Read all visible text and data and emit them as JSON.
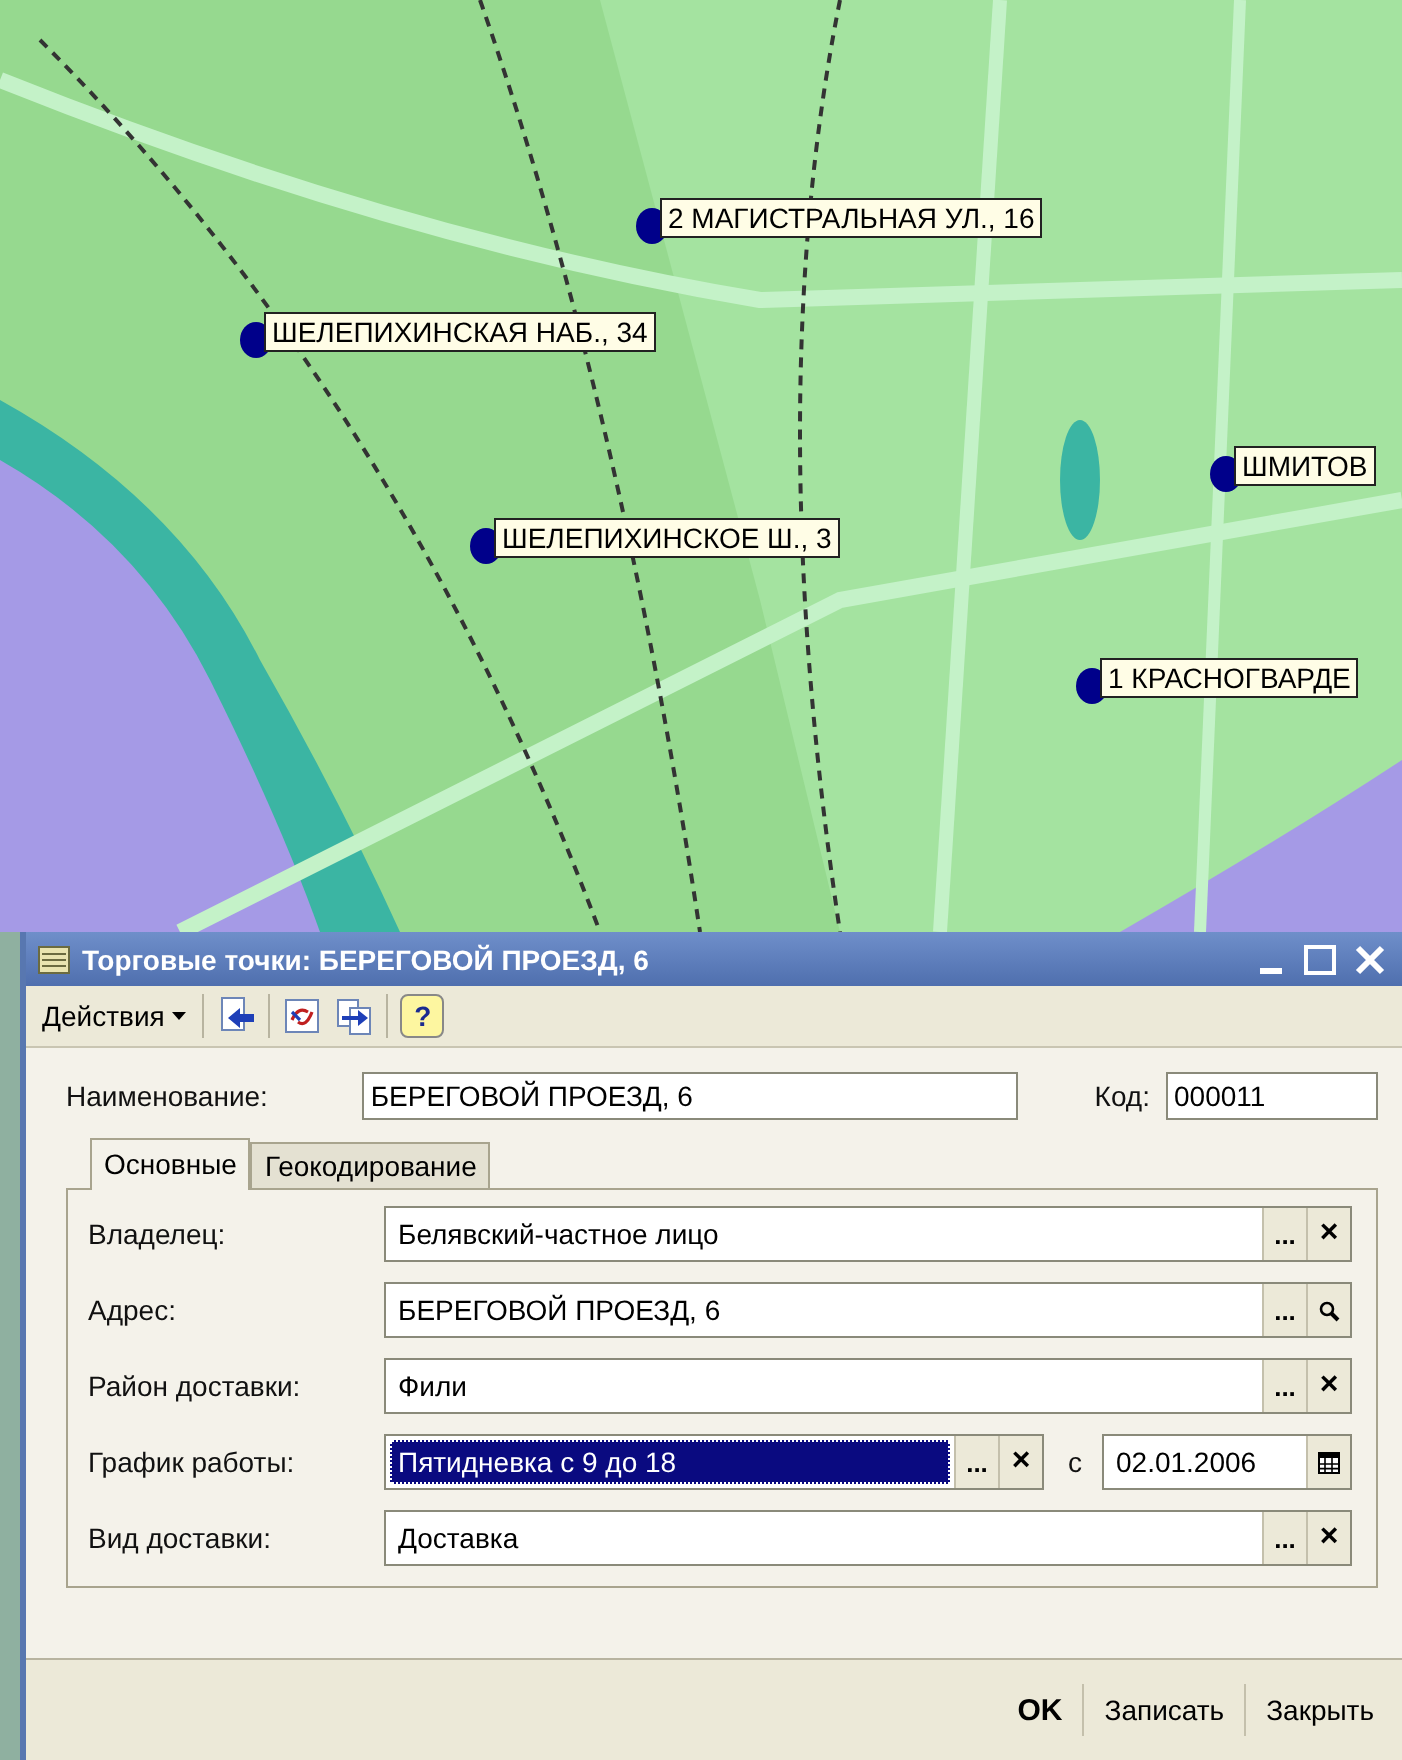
{
  "map": {
    "kind": "picture",
    "markers": [
      {
        "label": "2 МАГИСТРАЛЬНАЯ УЛ., 16"
      },
      {
        "label": "ШЕЛЕПИХИНСКАЯ НАБ., 34"
      },
      {
        "label": "ШЕЛЕПИХИНСКОЕ Ш., 3"
      },
      {
        "label": "ШМИТОВ"
      },
      {
        "label": "1 КРАСНОГВАРДЕ"
      }
    ]
  },
  "dialog": {
    "title": "Торговые точки: БЕРЕГОВОЙ ПРОЕЗД, 6",
    "toolbar": {
      "actions_menu": "Действия",
      "help": "?"
    },
    "name": {
      "label": "Наименование:",
      "value": "БЕРЕГОВОЙ ПРОЕЗД, 6"
    },
    "code": {
      "label": "Код:",
      "value": "000011"
    },
    "tabs": [
      {
        "label": "Основные",
        "selected": true
      },
      {
        "label": "Геокодирование",
        "selected": false
      }
    ],
    "fields": [
      {
        "label": "Владелец:",
        "value": "Белявский-частное лицо",
        "selected": false,
        "actions": [
          {
            "kind": "choose",
            "text": "..."
          },
          {
            "kind": "clear",
            "text": "×"
          }
        ]
      },
      {
        "label": "Адрес:",
        "value": "БЕРЕГОВОЙ ПРОЕЗД, 6",
        "selected": false,
        "actions": [
          {
            "kind": "choose",
            "text": "..."
          },
          {
            "kind": "search"
          }
        ]
      },
      {
        "label": "Район доставки:",
        "value": "Фили",
        "selected": false,
        "actions": [
          {
            "kind": "choose",
            "text": "..."
          },
          {
            "kind": "clear",
            "text": "×"
          }
        ]
      },
      {
        "label": "График работы:",
        "value": "Пятидневка с 9 до 18",
        "selected": true,
        "actions": [
          {
            "kind": "choose",
            "text": "..."
          },
          {
            "kind": "clear",
            "text": "×"
          }
        ],
        "date_prefix": "с",
        "date": "02.01.2006"
      },
      {
        "label": "Вид доставки:",
        "value": "Доставка",
        "selected": false,
        "actions": [
          {
            "kind": "choose",
            "text": "..."
          },
          {
            "kind": "clear",
            "text": "×"
          }
        ]
      }
    ],
    "buttons": [
      {
        "label": "OK",
        "default": true
      },
      {
        "label": "Записать",
        "default": false
      },
      {
        "label": "Закрыть",
        "default": false
      }
    ]
  }
}
